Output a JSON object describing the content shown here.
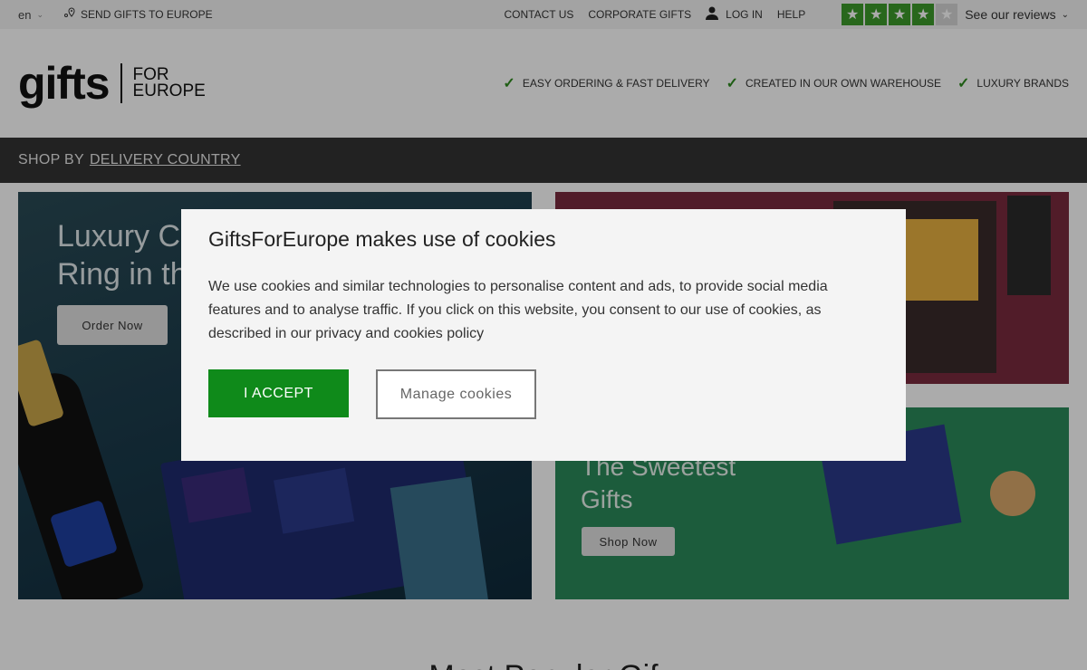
{
  "topbar": {
    "language": "en",
    "send_gifts": "SEND GIFTS TO EUROPE",
    "links": [
      "CONTACT US",
      "CORPORATE GIFTS"
    ],
    "login": "LOG IN",
    "help": "HELP",
    "rating_stars": 4,
    "rating_max": 5,
    "reviews": "See our reviews"
  },
  "header": {
    "logo_main": "gifts",
    "logo_sub_1": "FOR",
    "logo_sub_2": "EUROPE",
    "usps": [
      "EASY ORDERING & FAST DELIVERY",
      "CREATED IN OUR OWN WAREHOUSE",
      "LUXURY BRANDS"
    ]
  },
  "navbar": {
    "prefix": "SHOP BY",
    "link": "DELIVERY COUNTRY"
  },
  "hero": {
    "title_line1": "Luxury C",
    "title_line2": "Ring in th",
    "button": "Order Now"
  },
  "promo2": {
    "title_line1": "The Sweetest",
    "title_line2": "Gifts",
    "button": "Shop Now"
  },
  "section_title": "Most Popular Gif",
  "cookie": {
    "title": "GiftsForEurope makes use of cookies",
    "body": "We use cookies and similar technologies to personalise content and ads, to provide social media features and to analyse traffic. If you click on this website, you consent to our use of cookies, as described in our privacy and cookies policy",
    "accept": "I ACCEPT",
    "manage": "Manage cookies"
  },
  "colors": {
    "accent_green": "#0f8a1a",
    "trustpilot_green": "#3c9a2a",
    "navbar": "#333333"
  }
}
